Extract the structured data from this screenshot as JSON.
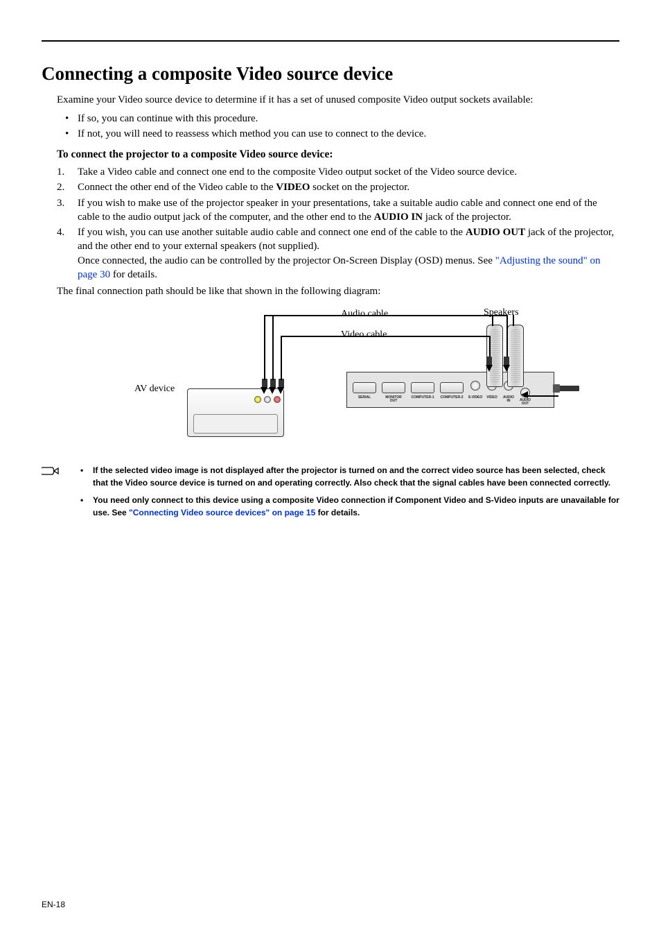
{
  "page_number_label": "EN-18",
  "heading": "Connecting a composite Video source device",
  "intro": "Examine your Video source device to determine if it has a set of unused composite Video output sockets available:",
  "bullets": [
    "If so, you can continue with this procedure.",
    "If not, you will need to reassess which method you can use to connect to the device."
  ],
  "subheading": "To connect the projector to a composite Video source device:",
  "steps": {
    "s1": "Take a Video cable and connect one end to the composite Video output socket of the Video source device.",
    "s2_pre": "Connect the other end of the Video cable to the ",
    "s2_bold": "VIDEO",
    "s2_post": " socket on the projector.",
    "s3_pre": "If you wish to make use of the projector speaker in your presentations, take a suitable audio cable and connect one end of the cable to the audio output jack of the computer, and the other end to the ",
    "s3_bold": "AUDIO IN",
    "s3_post": " jack of the projector.",
    "s4_pre": "If you wish, you can use another suitable audio cable and connect one end of the cable to the ",
    "s4_bold": "AUDIO OUT",
    "s4_mid": " jack of the projector, and the other end to your external speakers (not supplied).",
    "s4_line2_pre": "Once connected, the audio can be controlled by the projector On-Screen Display (OSD) menus. See ",
    "s4_link": "\"Adjusting the sound\" on page 30",
    "s4_line2_post": " for details."
  },
  "final_line": "The final connection path should be like that shown in the following diagram:",
  "diagram": {
    "audio_cable": "Audio cable",
    "video_cable": "Video cable",
    "speakers": "Speakers",
    "av_device": "AV device",
    "ports": {
      "serial": "SERIAL",
      "monitor_out": "MONITOR\nOUT",
      "computer1": "COMPUTER-1",
      "computer2": "COMPUTER-2",
      "svideo": "S-VIDEO",
      "video": "VIDEO",
      "audio_in": "AUDIO\nIN",
      "audio_out": "AUDIO\nOUT"
    }
  },
  "notes": {
    "n1": "If the selected video image is not displayed after the projector is turned on and the correct video source has been selected, check that the Video source device is turned on and operating correctly. Also check that the signal cables have been connected correctly.",
    "n2_pre": "You need only connect to this device using a composite Video connection if Component Video and S-Video inputs are unavailable for use. See ",
    "n2_link": "\"Connecting Video source devices\" on page 15",
    "n2_post": " for details."
  }
}
